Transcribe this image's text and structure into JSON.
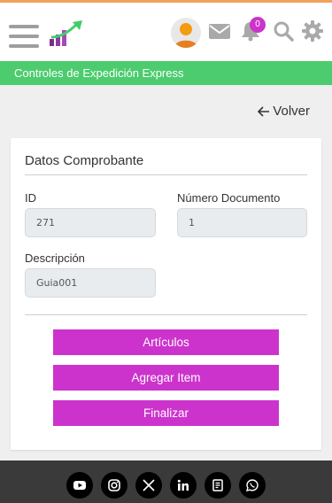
{
  "header": {
    "notification_count": "0",
    "accent_color": "#cc33cc",
    "top_border_color": "#f0a35c"
  },
  "titlebar": {
    "title": "Controles de Expedición Express",
    "color": "#4ccc6e"
  },
  "back_link": {
    "label": "Volver"
  },
  "card": {
    "title": "Datos Comprobante",
    "fields": {
      "id": {
        "label": "ID",
        "value": "271"
      },
      "numero_documento": {
        "label": "Número Documento",
        "value": "1"
      },
      "descripcion": {
        "label": "Descripción",
        "value": "Guia001"
      }
    },
    "buttons": {
      "articulos": "Artículos",
      "agregar_item": "Agregar Item",
      "finalizar": "Finalizar"
    }
  },
  "footer": {
    "social": [
      "youtube-icon",
      "instagram-icon",
      "x-icon",
      "linkedin-icon",
      "document-icon",
      "whatsapp-icon"
    ]
  }
}
